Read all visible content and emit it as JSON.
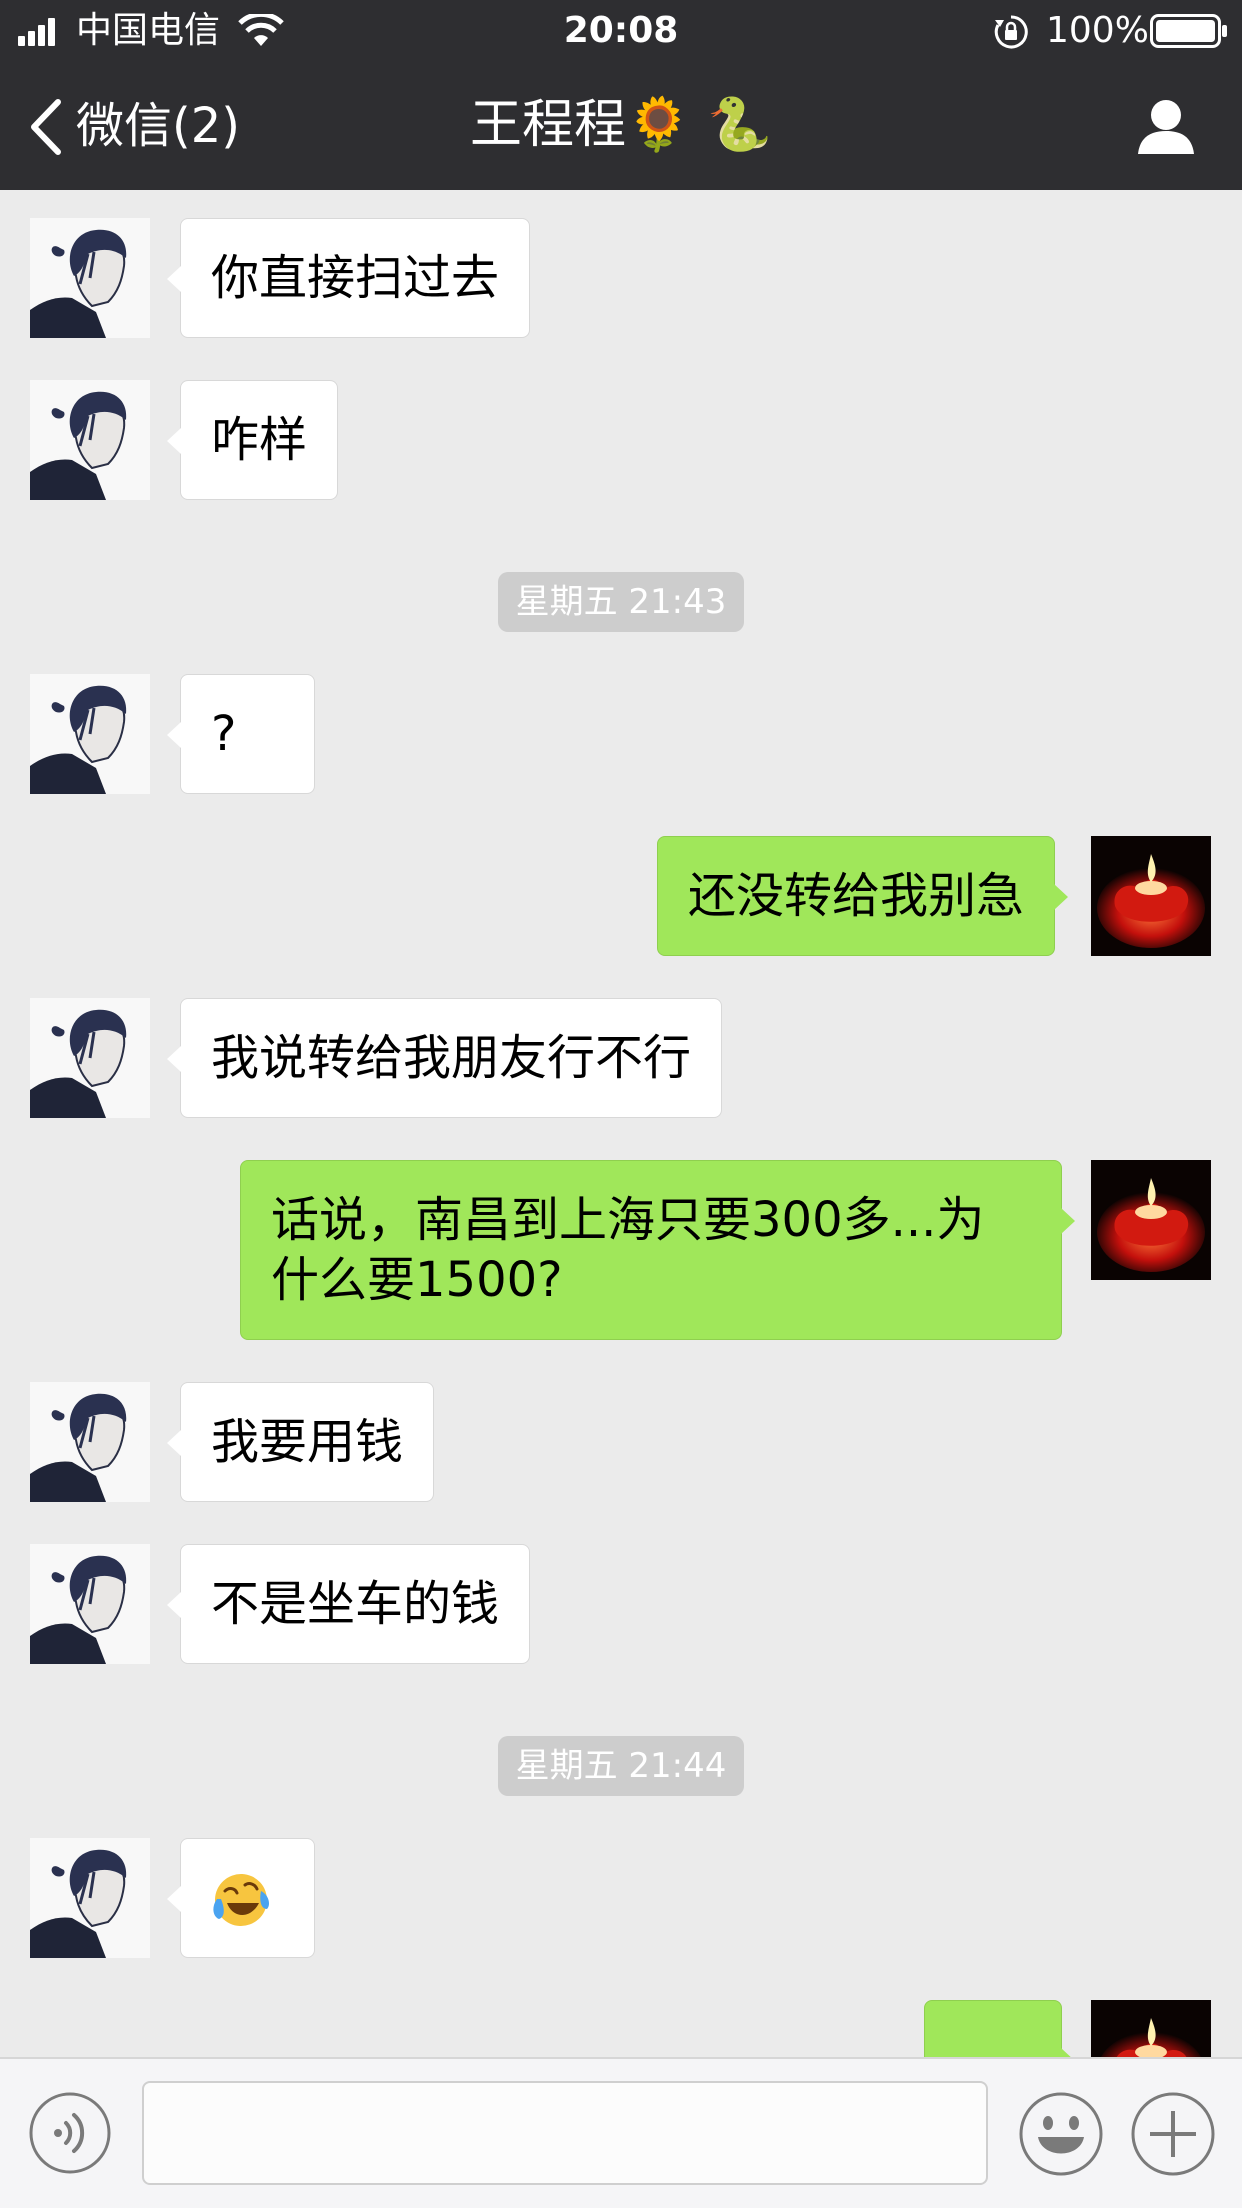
{
  "status_bar": {
    "carrier": "中国电信",
    "time": "20:08",
    "battery_percent": "100%",
    "battery_level": 1.0,
    "icons": [
      "signal-icon",
      "wifi-icon",
      "rotation-lock-icon",
      "battery-icon"
    ]
  },
  "nav": {
    "back_label": "微信(2)",
    "title": "王程程🌻 🐍",
    "icons": [
      "chevron-left-icon",
      "person-icon"
    ]
  },
  "messages": [
    {
      "from": "them",
      "text": "你直接扫过去"
    },
    {
      "from": "them",
      "text": "咋样"
    },
    {
      "type": "timestamp",
      "text": "星期五 21:43"
    },
    {
      "from": "them",
      "text": "?"
    },
    {
      "from": "me",
      "text": "还没转给我别急"
    },
    {
      "from": "them",
      "text": "我说转给我朋友行不行"
    },
    {
      "from": "me",
      "text": "话说，南昌到上海只要300多...为什么要1500?"
    },
    {
      "from": "them",
      "text": "我要用钱"
    },
    {
      "from": "them",
      "text": "不是坐车的钱"
    },
    {
      "type": "timestamp",
      "text": "星期五 21:44"
    },
    {
      "from": "them",
      "emoji": "crying-laughing-face-icon"
    },
    {
      "from": "me",
      "text": ""
    }
  ],
  "input_bar": {
    "text": "",
    "icons": [
      "voice-icon",
      "emoji-icon",
      "plus-icon"
    ]
  },
  "colors": {
    "header_bg": "#2e2e31",
    "chat_bg": "#ebebeb",
    "my_bubble": "#a0e75a",
    "their_bubble": "#ffffff",
    "timestamp_bg": "#cdcdcd"
  }
}
